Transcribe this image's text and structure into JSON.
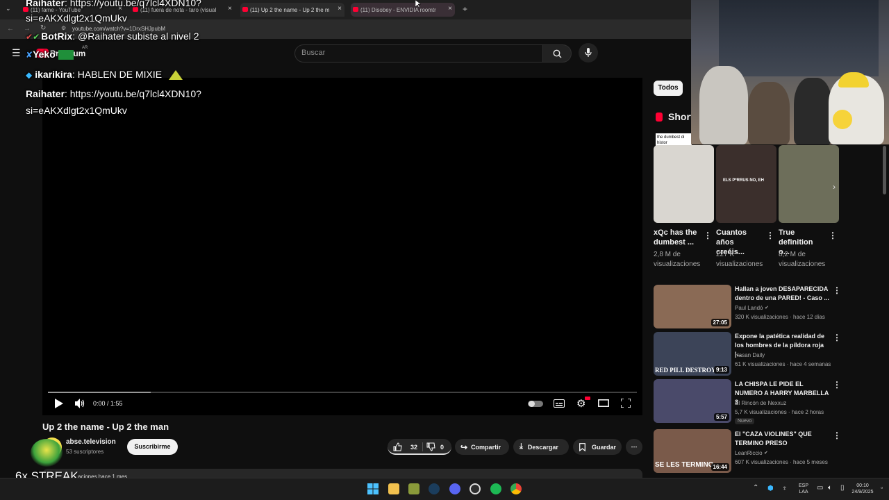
{
  "browser": {
    "tabs": [
      {
        "label": "(11) fame - YouTube"
      },
      {
        "label": "(11) fuera de nota - taro (visual"
      },
      {
        "label": "(11) Up 2 the name - Up 2 the m"
      },
      {
        "label": "(11) Disobey - ENVIDIA roomtr"
      }
    ],
    "new_tab": "+",
    "url": "youtube.com/watch?v=1DrxSHJpubM"
  },
  "header": {
    "logo": "Premium",
    "logo_region": "AR",
    "search_placeholder": "Buscar"
  },
  "player": {
    "time": "0:00 / 1:55",
    "buffered_fraction": 0.175,
    "played_fraction": 0.0
  },
  "video": {
    "title": "Up 2 the name - Up 2 the man",
    "channel": "abse.television",
    "subscribers": "53 suscriptores",
    "subscribe_label": "Suscribirme",
    "likes": "32",
    "dislikes": "0",
    "share_label": "Compartir",
    "download_label": "Descargar",
    "save_label": "Guardar",
    "more_label": "⋯",
    "description_meta": "aciones  hace 1 mes"
  },
  "sidebar": {
    "chip": "Todos",
    "shorts_title": "Short",
    "shorts_caption_snippet": "the dumbest di histor",
    "shorts": [
      {
        "title": "xQc has the dumbest ...",
        "views": "2,8 M de visualizaciones",
        "thumb_color": "#d9d6d0"
      },
      {
        "title": "Cuantos años creéis...",
        "views": "227 K visualizaciones",
        "thumb_color": "#3b2f2c",
        "overlay": "ELS P*RRUS NO, EH"
      },
      {
        "title": "True definition o...",
        "views": "8,2 M de visualizaciones",
        "thumb_color": "#6d6e5a"
      }
    ],
    "recommended": [
      {
        "title": "Hallan a joven DESAPARECIDA dentro de una PARED! - Caso ...",
        "channel": "Paul Landó",
        "verified": true,
        "meta": "320 K visualizaciones · hace 12 días",
        "duration": "27:05",
        "thumb_color": "#8a6a55"
      },
      {
        "title": "Expone la patética realidad de los hombres de la píldora roja |...",
        "channel": "Hasan Daily",
        "verified": false,
        "meta": "61 K visualizaciones · hace 4 semanas",
        "duration": "9:13",
        "thumb_color": "#3c4458",
        "overlay": "RED PILL DESTROYED"
      },
      {
        "title": "LA CHISPA LE PIDE EL NUMERO A HARRY MARBELLA 3",
        "channel": "El Rincón de Nexxuz",
        "verified": false,
        "meta": "5,7 K visualizaciones · hace 2 horas",
        "badge": "Nuevo",
        "duration": "5:57",
        "thumb_color": "#4a4a6a"
      },
      {
        "title": "El \"CAZA VIOLINES\" QUE TERMINO PRESO",
        "channel": "LeanRiccio",
        "verified": true,
        "meta": "607 K visualizaciones · hace 5 meses",
        "duration": "16:44",
        "thumb_color": "#7a5a4a",
        "overlay": "SE LES TERMINO"
      }
    ]
  },
  "chat": [
    {
      "user": "Raihater",
      "text": ": https://youtu.be/q7lcl4XDN10?",
      "user_color": "#ffffff"
    },
    {
      "user": "",
      "text": "si=eAKXdlgt2x1QmUkv",
      "user_color": "#ffffff"
    },
    {
      "user": "BotRix",
      "text": ": @Raihater subiste al nivel 2",
      "user_color": "#ffffff"
    },
    {
      "user": "Yeko",
      "text": "",
      "user_color": "#ffffff"
    },
    {
      "user": "ikarikira",
      "text": ": HABLEN DE MIXIE",
      "user_color": "#ffffff"
    },
    {
      "user": "Raihater",
      "text": ": https://youtu.be/q7lcl4XDN10?",
      "user_color": "#ffffff"
    },
    {
      "user": "",
      "text": "si=eAKXdlgt2x1QmUkv",
      "user_color": "#ffffff"
    }
  ],
  "stream_label": "6x STREAK",
  "taskbar": {
    "lang_top": "ESP",
    "lang_bottom": "LAA",
    "time": "00:10",
    "date": "24/9/2025"
  },
  "colors": {
    "yt_red": "#ff0033",
    "bg": "#0f0f0f",
    "surface": "#272727"
  }
}
